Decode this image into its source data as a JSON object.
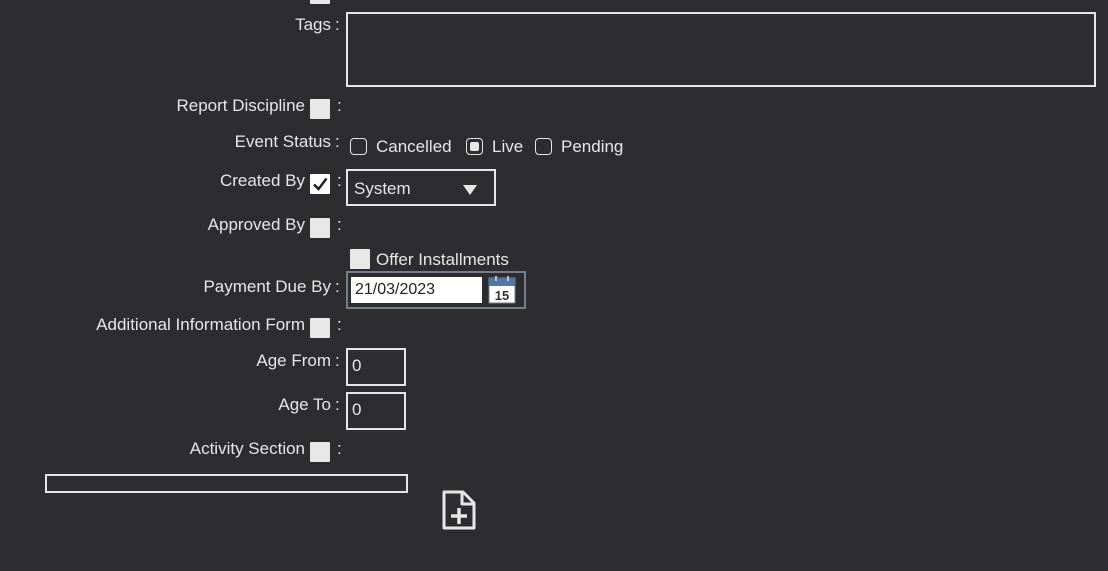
{
  "form": {
    "tags_label": "Tags",
    "report_discipline_label": "Report Discipline",
    "event_status_label": "Event Status",
    "event_status_options": [
      {
        "label": "Cancelled",
        "selected": false
      },
      {
        "label": "Live",
        "selected": true
      },
      {
        "label": "Pending",
        "selected": false
      }
    ],
    "created_by_label": "Created By",
    "created_by_checked": true,
    "created_by_value": "System",
    "approved_by_label": "Approved By",
    "offer_installments_label": "Offer Installments",
    "payment_due_label": "Payment Due By",
    "payment_due_value": "21/03/2023",
    "calendar_day": "15",
    "additional_info_label": "Additional Information Form",
    "age_from_label": "Age From",
    "age_from_value": "0",
    "age_to_label": "Age To",
    "age_to_value": "0",
    "activity_section_label": "Activity Section",
    "colon": ":"
  },
  "icons": {
    "dropdown": "chevron-down-icon",
    "calendar": "calendar-icon",
    "add_file": "add-file-icon"
  },
  "colors": {
    "background": "#2d2d30",
    "text": "#e6e6e6",
    "date_border": "#6e7f94"
  }
}
